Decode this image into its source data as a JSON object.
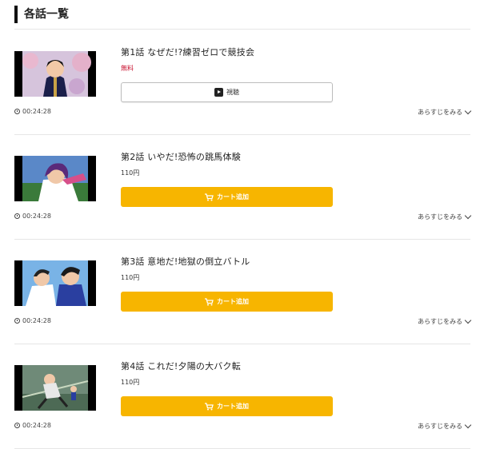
{
  "section": {
    "title": "各話一覧"
  },
  "episodes": [
    {
      "title": "第1話 なぜだ!?練習ゼロで競技会",
      "price": "無料",
      "button": "視聴",
      "duration": "00:24:28",
      "synopsis": "あらすじをみる"
    },
    {
      "title": "第2話 いやだ!恐怖の跳馬体験",
      "price": "110円",
      "button": "カート追加",
      "duration": "00:24:28",
      "synopsis": "あらすじをみる"
    },
    {
      "title": "第3話 意地だ!地獄の倒立バトル",
      "price": "110円",
      "button": "カート追加",
      "duration": "00:24:28",
      "synopsis": "あらすじをみる"
    },
    {
      "title": "第4話 これだ!夕陽の大バク転",
      "price": "110円",
      "button": "カート追加",
      "duration": "00:24:28",
      "synopsis": "あらすじをみる"
    }
  ],
  "colors": {
    "accent": "#f7b500",
    "free": "#c8102e",
    "divider": "#e6e6e6"
  },
  "icons": {
    "watch": "play-icon",
    "cart": "cart-icon",
    "time": "clock-icon",
    "synopsis": "chevron-down-icon"
  }
}
